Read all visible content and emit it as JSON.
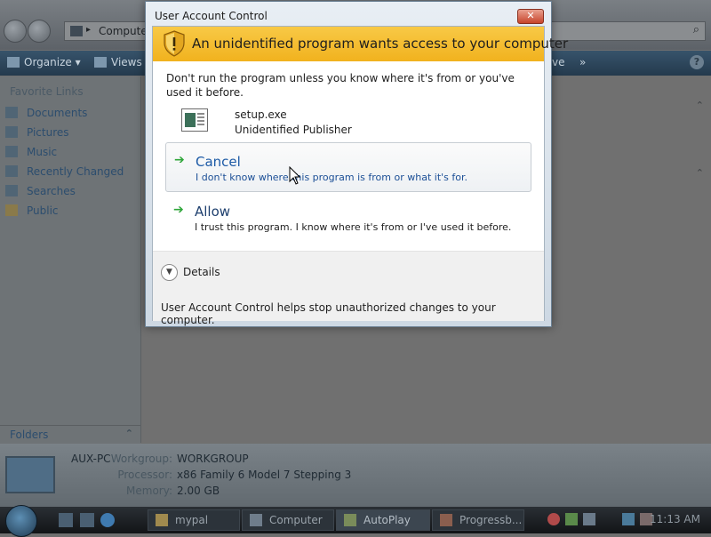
{
  "explorer": {
    "address_text": "Compute",
    "commands": [
      "Organize",
      "Views",
      "ve",
      "»"
    ],
    "favorite_links_title": "Favorite Links",
    "favorite_links": [
      "Documents",
      "Pictures",
      "Music",
      "Recently Changed",
      "Searches",
      "Public"
    ],
    "folders_label": "Folders",
    "details": {
      "pc_name": "AUX-PC",
      "rows": [
        {
          "label": "Workgroup:",
          "value": "WORKGROUP"
        },
        {
          "label": "Processor:",
          "value": "x86 Family 6 Model 7 Stepping 3"
        },
        {
          "label": "Memory:",
          "value": "2.00 GB"
        }
      ]
    }
  },
  "taskbar": {
    "buttons": [
      {
        "label": "mypal",
        "active": false
      },
      {
        "label": "Computer",
        "active": false
      },
      {
        "label": "AutoPlay",
        "active": true
      },
      {
        "label": "Progressb...",
        "active": false
      }
    ],
    "clock": "11:13 AM"
  },
  "uac": {
    "window_title": "User Account Control",
    "close_glyph": "✕",
    "banner": "An unidentified program wants access to your computer",
    "warning": "Don't run the program unless you know where it's from or you've used it before.",
    "program_name": "setup.exe",
    "publisher": "Unidentified Publisher",
    "cancel": {
      "title": "Cancel",
      "description": "I don't know where this program is from or what it's for."
    },
    "allow": {
      "title": "Allow",
      "description": "I trust this program. I know where it's from or I've used it before."
    },
    "details_label": "Details",
    "footer": "User Account Control helps stop unauthorized changes to your computer.",
    "colors": {
      "banner": "#f1b21e",
      "option_title": "#1c5aa6",
      "arrow": "#2fa63a"
    }
  }
}
